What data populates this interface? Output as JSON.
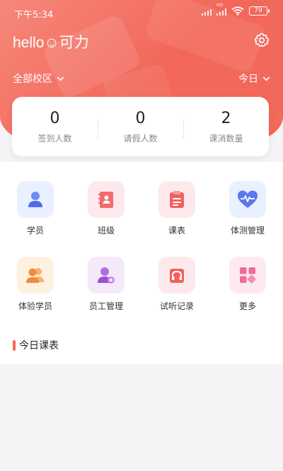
{
  "status_bar": {
    "time": "下午5:34",
    "network": "HD",
    "battery": "79"
  },
  "header": {
    "greeting": "hello☺可力",
    "campus_selector": "全部校区",
    "date_selector": "今日"
  },
  "stats": [
    {
      "value": "0",
      "label": "签到人数"
    },
    {
      "value": "0",
      "label": "请假人数"
    },
    {
      "value": "2",
      "label": "课消数量"
    }
  ],
  "menu": [
    {
      "label": "学员",
      "icon": "student-icon"
    },
    {
      "label": "班级",
      "icon": "class-book-icon"
    },
    {
      "label": "课表",
      "icon": "schedule-clipboard-icon"
    },
    {
      "label": "体测管理",
      "icon": "heart-pulse-icon"
    },
    {
      "label": "体验学员",
      "icon": "trial-students-icon"
    },
    {
      "label": "员工管理",
      "icon": "staff-gear-icon"
    },
    {
      "label": "试听记录",
      "icon": "audition-headphones-icon"
    },
    {
      "label": "更多",
      "icon": "more-grid-icon"
    }
  ],
  "section": {
    "title": "今日课表"
  },
  "colors": {
    "brand": "#f26a5c",
    "card": "#ffffff",
    "background": "#f4f4f6"
  }
}
